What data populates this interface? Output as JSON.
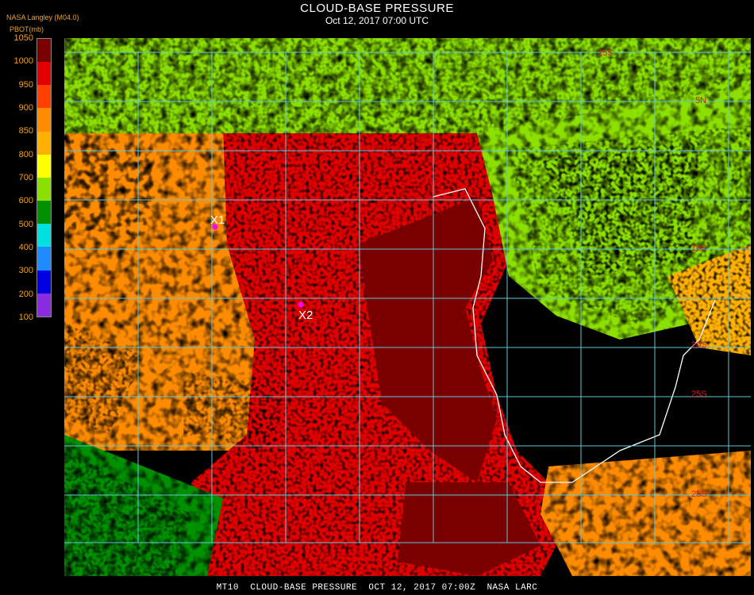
{
  "header": {
    "title": "CLOUD-BASE PRESSURE",
    "subtitle": "Oct 12, 2017 07:00 UTC",
    "credit": "NASA Langley (M04.0)",
    "units_label": "PBOT(mb)"
  },
  "legend": {
    "ticks": [
      "1050",
      "1000",
      "950",
      "900",
      "850",
      "800",
      "700",
      "600",
      "500",
      "400",
      "300",
      "200",
      "100"
    ],
    "segments": [
      {
        "color": "#7a0000"
      },
      {
        "color": "#e00000"
      },
      {
        "color": "#ff4000"
      },
      {
        "color": "#ff8c00"
      },
      {
        "color": "#ffb000"
      },
      {
        "color": "#ffff00"
      },
      {
        "color": "#8ce000"
      },
      {
        "color": "#009000"
      },
      {
        "color": "#00e0e0"
      },
      {
        "color": "#1e8cff"
      },
      {
        "color": "#0000e0"
      },
      {
        "color": "#8a2be2"
      }
    ]
  },
  "map": {
    "markers": [
      {
        "label": "X1",
        "color": "#ff00ff"
      },
      {
        "label": "X2",
        "color": "#ff00ff"
      }
    ],
    "grid_labels": [
      "25S",
      "5N",
      "10S",
      "20S",
      "25S",
      "25S"
    ],
    "grid_color": "#60c8d8"
  },
  "footer": {
    "text": "MT10  CLOUD-BASE PRESSURE  OCT 12, 2017 07:00Z  NASA LARC"
  }
}
